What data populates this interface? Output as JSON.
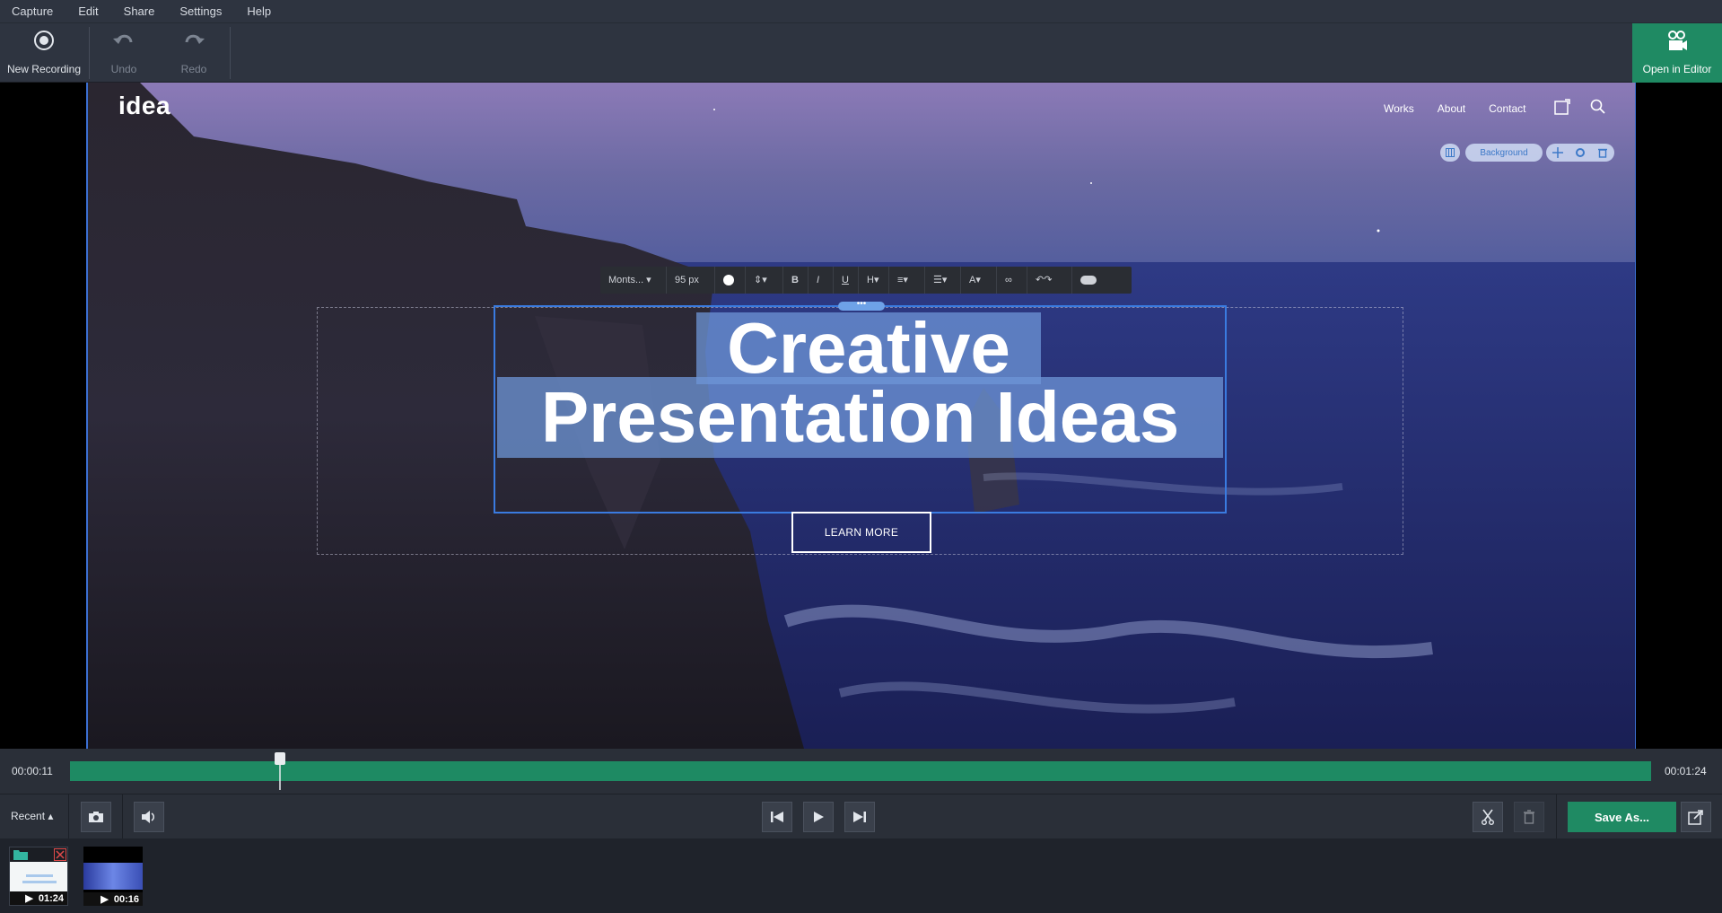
{
  "menubar": {
    "items": [
      "Capture",
      "Edit",
      "Share",
      "Settings",
      "Help"
    ]
  },
  "toolbar": {
    "new_recording": "New Recording",
    "undo": "Undo",
    "redo": "Redo",
    "open_in_editor": "Open in Editor"
  },
  "website": {
    "logo": "idea",
    "nav": [
      "Works",
      "About",
      "Contact"
    ],
    "background_label": "Background",
    "format_bar": {
      "font": "Monts...",
      "size": "95 px",
      "bold": "B",
      "italic": "I",
      "underline": "U",
      "heading": "H"
    },
    "headline_line1": "Creative",
    "headline_line2": "Presentation Ideas",
    "button": "LEARN MORE"
  },
  "timeline": {
    "current_time": "00:00:11",
    "total_time": "00:01:24",
    "progress": 0.13
  },
  "controls": {
    "recent_label": "Recent",
    "save_as": "Save As..."
  },
  "recent_recordings": [
    {
      "duration": "01:24"
    },
    {
      "duration": "00:16"
    }
  ],
  "colors": {
    "accent": "#1f8a63",
    "selection": "#3a7be0",
    "background": "#2e3440"
  }
}
